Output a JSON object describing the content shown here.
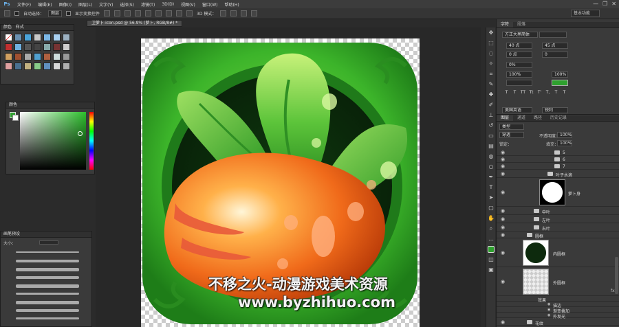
{
  "app": {
    "logo": "Ps"
  },
  "menu": [
    "文件(F)",
    "编辑(E)",
    "图像(I)",
    "图层(L)",
    "文字(Y)",
    "选择(S)",
    "滤镜(T)",
    "3D(D)",
    "视图(V)",
    "窗口(W)",
    "帮助(H)"
  ],
  "window_controls": {
    "minimize": "—",
    "restore": "❐",
    "close": "✕"
  },
  "options_bar": {
    "auto_select_label": "自动选择：",
    "auto_select_value": "图层",
    "show_transform_label": "显示变换控件",
    "mode_label": "3D 模式：",
    "workspace": "基本功能"
  },
  "document": {
    "tab_title": "卫萝卜-icon.psd @ 56.9% (萝卜, RGB/8#) *"
  },
  "left_panels": {
    "swatches_tabs": [
      "颜色",
      "样式"
    ],
    "color_panel_title": "颜色",
    "brush_panel_title": "画笔预设",
    "brush_size_label": "大小："
  },
  "character_panel": {
    "tabs": [
      "字符",
      "段落"
    ],
    "font_family": "方正大黑简体",
    "font_size": "40 点",
    "leading": "45 点",
    "kerning": "0 点",
    "tracking": "0",
    "baseline": "0%",
    "vertical_scale": "100%",
    "horizontal_scale": "100%",
    "color_swatch": "#2ea02e",
    "language": "美国英语",
    "antialias": "锐利",
    "format_buttons": [
      "T",
      "T",
      "TT",
      "Tt",
      "T'",
      "T,",
      "T",
      "T"
    ]
  },
  "layers_panel": {
    "tabs": [
      "图层",
      "通道",
      "路径",
      "历史记录"
    ],
    "filter_kind": "类型",
    "blend_mode": "穿透",
    "opacity_label": "不透明度：",
    "opacity_value": "100%",
    "lock_label": "锁定：",
    "fill_label": "填充：",
    "fill_value": "100%",
    "layers": [
      {
        "name": "5",
        "type": "folder"
      },
      {
        "name": "6",
        "type": "folder"
      },
      {
        "name": "7",
        "type": "folder"
      },
      {
        "name": "叶子水滴",
        "type": "folder"
      },
      {
        "name": "萝卜身",
        "type": "layer-mask"
      },
      {
        "name": "中叶",
        "type": "folder"
      },
      {
        "name": "左叶",
        "type": "folder"
      },
      {
        "name": "右叶",
        "type": "folder"
      },
      {
        "name": "圆框",
        "type": "folder"
      },
      {
        "name": "内圆框",
        "type": "layer"
      },
      {
        "name": "外圆框",
        "type": "layer"
      },
      {
        "name": "效果",
        "type": "effect"
      },
      {
        "name": "描边",
        "type": "effect-item"
      },
      {
        "name": "渐变叠加",
        "type": "effect-item"
      },
      {
        "name": "外发光",
        "type": "effect-item"
      },
      {
        "name": "花纹",
        "type": "folder"
      }
    ],
    "fx_label": "fx"
  },
  "watermark": {
    "line1": "不移之火-动漫游戏美术资源",
    "line2": "www.byzhihuo.com"
  },
  "colors": {
    "green": "#2ea02e",
    "orange": "#f06a1a",
    "panel": "#3a3a3a"
  }
}
